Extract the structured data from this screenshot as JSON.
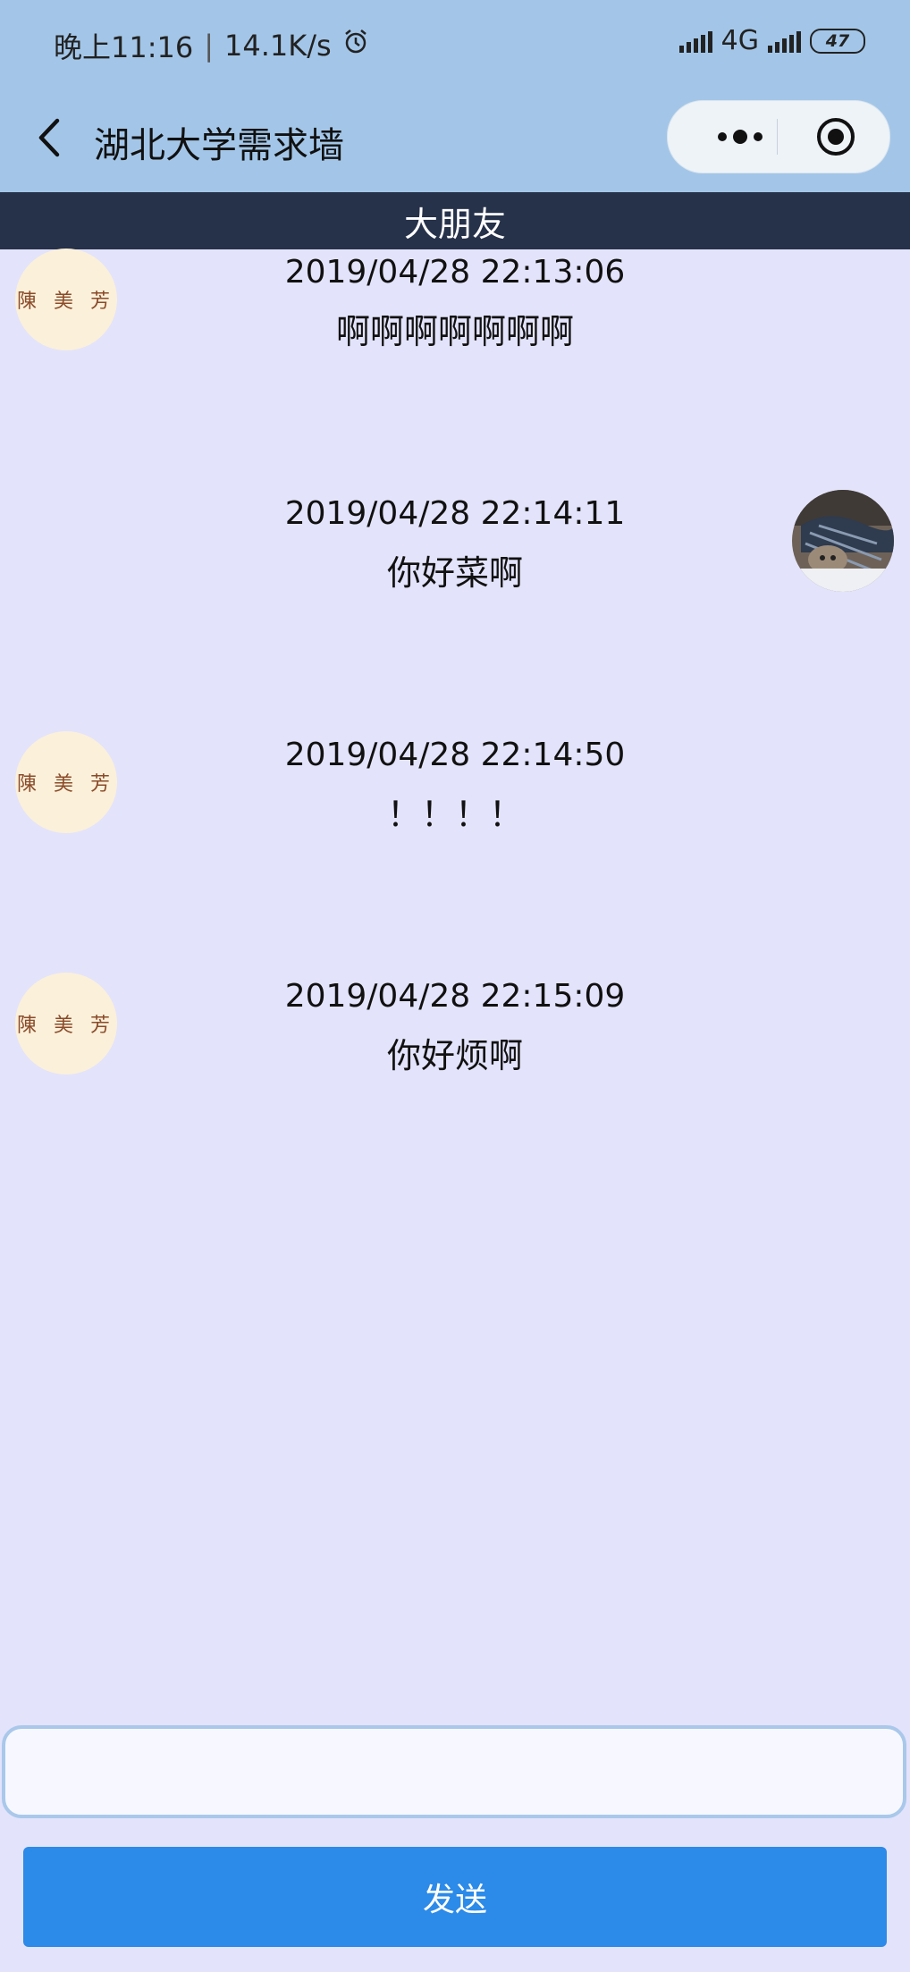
{
  "status": {
    "time": "晚上11:16",
    "divider": "|",
    "speed": "14.1K/s",
    "network": "4G",
    "battery": "47"
  },
  "navbar": {
    "title": "湖北大学需求墙"
  },
  "chat": {
    "partner_name": "大朋友",
    "messages": [
      {
        "side": "left",
        "time": "2019/04/28 22:13:06",
        "text": "啊啊啊啊啊啊啊",
        "avatar": "陳 美 芳"
      },
      {
        "side": "right",
        "time": "2019/04/28 22:14:11",
        "text": "你好菜啊",
        "avatar": ""
      },
      {
        "side": "left",
        "time": "2019/04/28 22:14:50",
        "text": "！！！！",
        "avatar": "陳 美 芳"
      },
      {
        "side": "left",
        "time": "2019/04/28 22:15:09",
        "text": "你好烦啊",
        "avatar": "陳 美 芳"
      }
    ]
  },
  "composer": {
    "input_value": "",
    "send_label": "发送"
  }
}
